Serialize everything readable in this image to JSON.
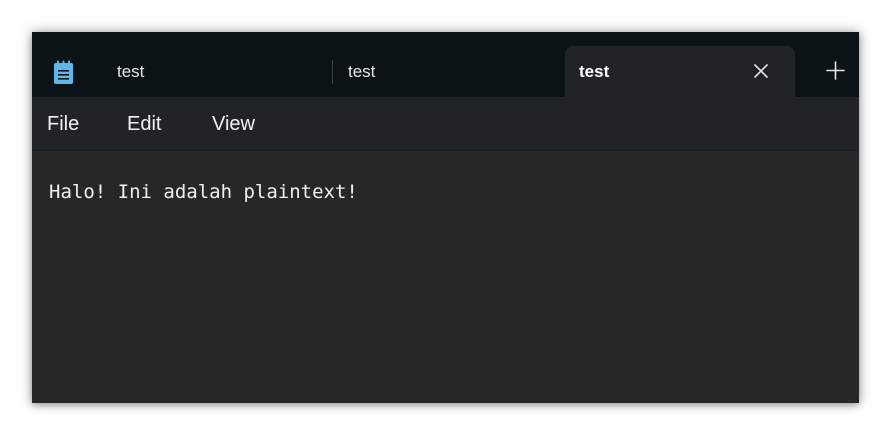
{
  "app": {
    "icon": "notepad-icon"
  },
  "tabs": [
    {
      "label": "test"
    },
    {
      "label": "test"
    },
    {
      "label": "test",
      "active": true
    }
  ],
  "icons": {
    "close": "close-icon",
    "new_tab": "plus-icon"
  },
  "menu": {
    "file": "File",
    "edit": "Edit",
    "view": "View"
  },
  "editor": {
    "content": "Halo! Ini adalah plaintext!"
  },
  "colors": {
    "titlebar": "#0c1317",
    "active_tab": "#202427",
    "editor_bg": "#272727",
    "notepad_icon": "#5fb7e8"
  }
}
